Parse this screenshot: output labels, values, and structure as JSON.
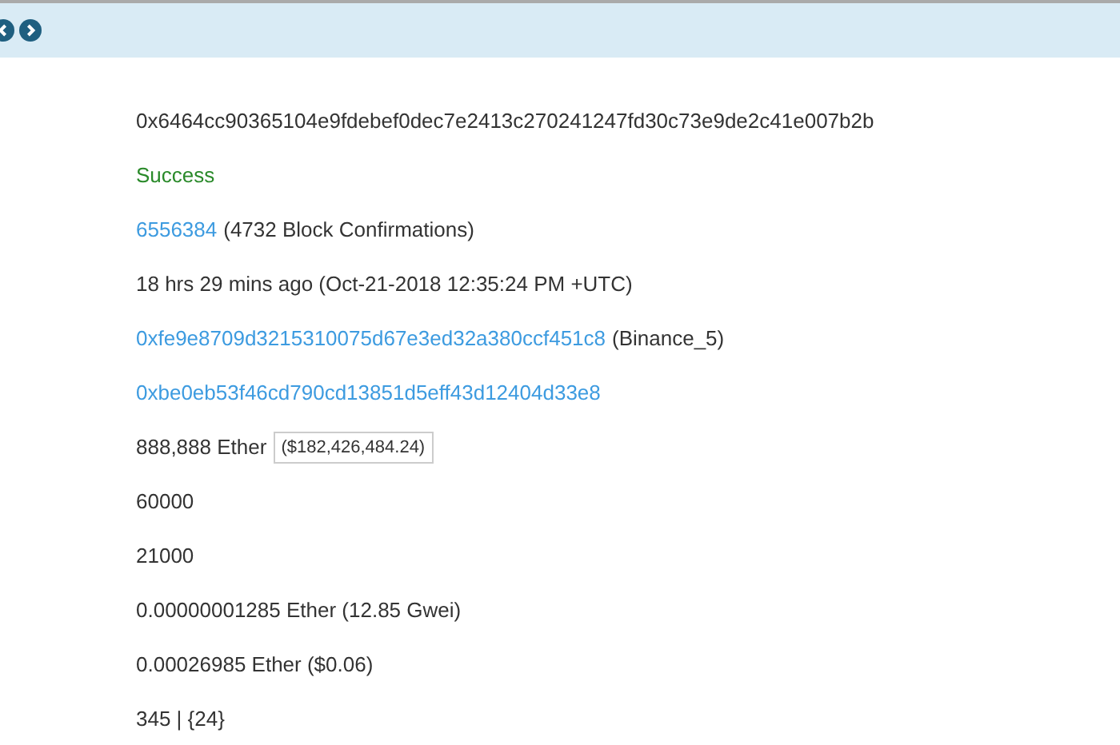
{
  "rows": [
    [
      {
        "kind": "plain",
        "text": "0x6464cc90365104e9fdebef0dec7e2413c270241247fd30c73e9de2c41e007b2b"
      }
    ],
    [
      {
        "kind": "status",
        "text": "Success"
      }
    ],
    [
      {
        "kind": "link",
        "text": "6556384"
      },
      {
        "kind": "plain",
        "text": "(4732 Block Confirmations)"
      }
    ],
    [
      {
        "kind": "plain",
        "text": "18 hrs 29 mins ago (Oct-21-2018 12:35:24 PM +UTC)"
      }
    ],
    [
      {
        "kind": "link",
        "text": "0xfe9e8709d3215310075d67e3ed32a380ccf451c8"
      },
      {
        "kind": "plain",
        "text": "(Binance_5)"
      }
    ],
    [
      {
        "kind": "link",
        "text": "0xbe0eb53f46cd790cd13851d5eff43d12404d33e8"
      }
    ],
    [
      {
        "kind": "plain",
        "text": "888,888 Ether"
      },
      {
        "kind": "badge",
        "text": "($182,426,484.24)"
      }
    ],
    [
      {
        "kind": "plain",
        "text": "60000"
      }
    ],
    [
      {
        "kind": "plain",
        "text": "21000"
      }
    ],
    [
      {
        "kind": "plain",
        "text": "0.00000001285 Ether (12.85 Gwei)"
      }
    ],
    [
      {
        "kind": "plain",
        "text": "0.00026985 Ether ($0.06)"
      }
    ],
    [
      {
        "kind": "plain",
        "text": "345 | {24}"
      }
    ]
  ]
}
